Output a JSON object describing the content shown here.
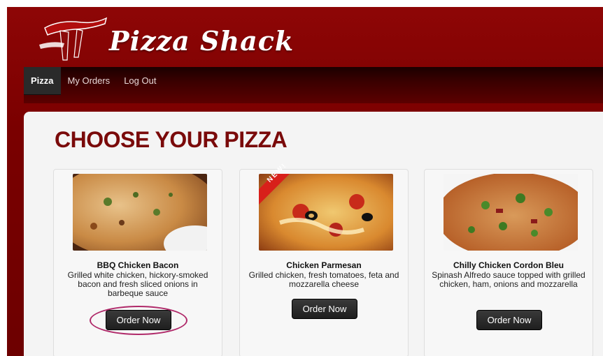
{
  "app": {
    "brand_name": "Pizza Shack"
  },
  "nav": {
    "items": [
      {
        "label": "Pizza",
        "active": true
      },
      {
        "label": "My Orders",
        "active": false
      },
      {
        "label": "Log Out",
        "active": false
      }
    ]
  },
  "main": {
    "title": "CHOOSE YOUR PIZZA",
    "cards": [
      {
        "name": "BBQ Chicken Bacon",
        "description": "Grilled white chicken, hickory-smoked bacon and fresh sliced onions in barbeque sauce",
        "button_label": "Order Now",
        "badge": ""
      },
      {
        "name": "Chicken Parmesan",
        "description": "Grilled chicken, fresh tomatoes, feta and mozzarella cheese",
        "button_label": "Order Now",
        "badge": "NEW!"
      },
      {
        "name": "Chilly Chicken Cordon Bleu",
        "description": "Spinash Alfredo sauce topped with grilled chicken, ham, onions and mozzarella",
        "button_label": "Order Now",
        "badge": ""
      }
    ]
  },
  "colors": {
    "header_bg": "#7a0000",
    "title_color": "#7a0a0a",
    "button_bg": "#2a2a2a",
    "highlight_ring": "#b02a6a"
  }
}
